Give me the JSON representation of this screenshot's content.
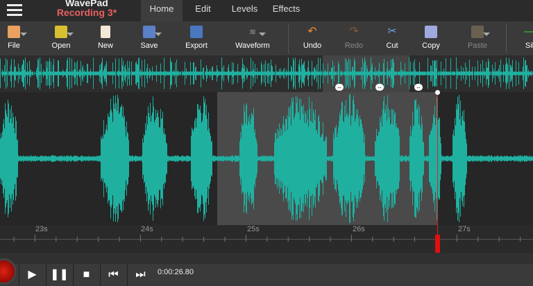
{
  "app": {
    "name": "WavePad",
    "document": "Recording 3*"
  },
  "tabs": [
    {
      "label": "Home",
      "active": true
    },
    {
      "label": "Edit"
    },
    {
      "label": "Levels"
    },
    {
      "label": "Effects"
    }
  ],
  "toolbar": {
    "file": "File",
    "open": "Open",
    "new": "New",
    "save": "Save",
    "export": "Export",
    "waveform": "Waveform",
    "undo": "Undo",
    "redo": "Redo",
    "cut": "Cut",
    "copy": "Copy",
    "paste": "Paste",
    "silence": "Sil"
  },
  "ruler": {
    "labels": [
      "23s",
      "24s",
      "25s",
      "26s",
      "27s"
    ]
  },
  "transport": {
    "time": "0:00:26.80"
  },
  "colors": {
    "wave": "#1fb0a0",
    "cursor": "#e02020",
    "title": "#e86060"
  }
}
